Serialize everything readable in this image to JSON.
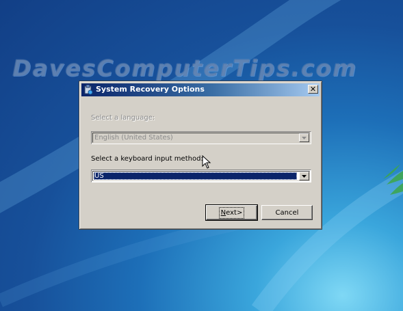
{
  "watermark": "DavesComputerTips.com",
  "dialog": {
    "title": "System Recovery Options",
    "close_label": "✕",
    "language_label": "Select a language:",
    "language_value": "English (United States)",
    "keyboard_label": "Select a keyboard input method:",
    "keyboard_value": "US",
    "next_label": "Next>",
    "cancel_label": "Cancel"
  },
  "icons": {
    "title": "recovery-tools-icon",
    "close": "close-icon",
    "dropdown": "chevron-down-icon",
    "cursor": "mouse-pointer-icon"
  },
  "colors": {
    "desktop": "#1d6fb8",
    "dialog_face": "#d4d0c8",
    "title_start": "#0a246a",
    "title_end": "#a6caf0",
    "selection": "#0a246a"
  }
}
